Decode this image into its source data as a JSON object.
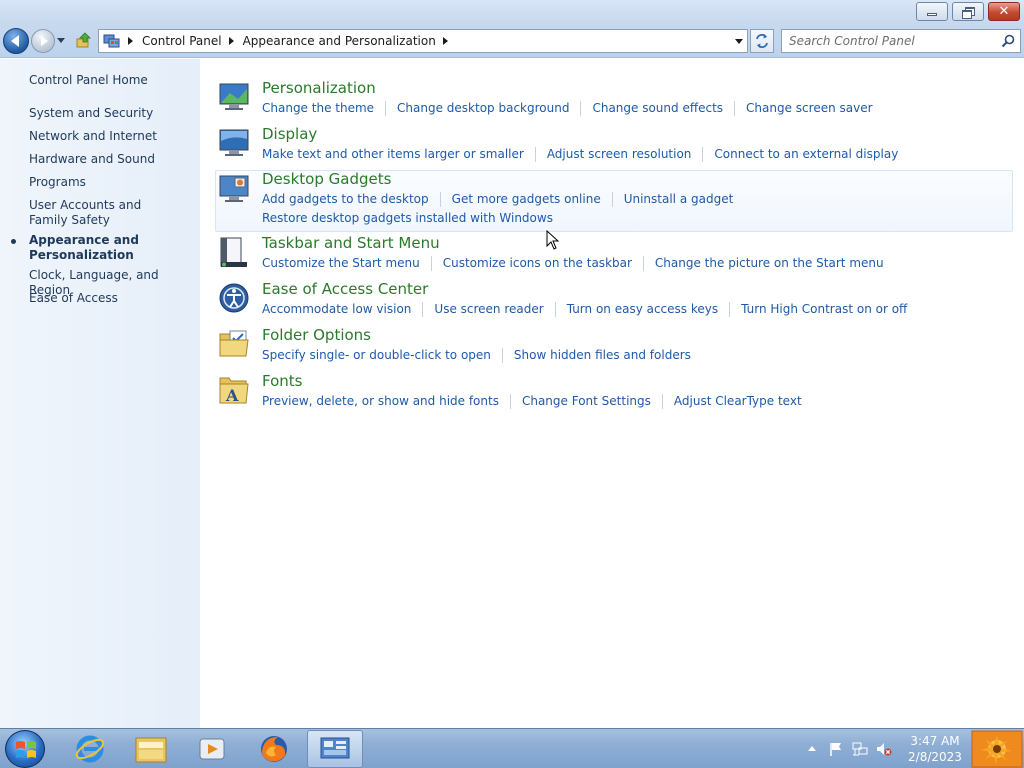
{
  "window": {
    "minimize_icon": "minimize-icon",
    "maximize_icon": "restore-icon",
    "close_icon": "close-icon",
    "close_glyph": "✕"
  },
  "nav": {
    "breadcrumbs": [
      "Control Panel",
      "Appearance and Personalization"
    ],
    "search_placeholder": "Search Control Panel"
  },
  "sidebar": {
    "home": "Control Panel Home",
    "items": [
      {
        "label": "System and Security",
        "active": false
      },
      {
        "label": "Network and Internet",
        "active": false
      },
      {
        "label": "Hardware and Sound",
        "active": false
      },
      {
        "label": "Programs",
        "active": false
      },
      {
        "label": "User Accounts and Family Safety",
        "active": false
      },
      {
        "label": "Appearance and Personalization",
        "active": true
      },
      {
        "label": "Clock, Language, and Region",
        "active": false
      },
      {
        "label": "Ease of Access",
        "active": false
      }
    ]
  },
  "categories": [
    {
      "title": "Personalization",
      "icon": "personalization-icon",
      "links": [
        "Change the theme",
        "Change desktop background",
        "Change sound effects",
        "Change screen saver"
      ]
    },
    {
      "title": "Display",
      "icon": "display-icon",
      "links": [
        "Make text and other items larger or smaller",
        "Adjust screen resolution",
        "Connect to an external display"
      ]
    },
    {
      "title": "Desktop Gadgets",
      "icon": "desktop-gadgets-icon",
      "links": [
        "Add gadgets to the desktop",
        "Get more gadgets online",
        "Uninstall a gadget",
        "Restore desktop gadgets installed with Windows"
      ]
    },
    {
      "title": "Taskbar and Start Menu",
      "icon": "taskbar-icon",
      "links": [
        "Customize the Start menu",
        "Customize icons on the taskbar",
        "Change the picture on the Start menu"
      ]
    },
    {
      "title": "Ease of Access Center",
      "icon": "ease-of-access-icon",
      "links": [
        "Accommodate low vision",
        "Use screen reader",
        "Turn on easy access keys",
        "Turn High Contrast on or off"
      ]
    },
    {
      "title": "Folder Options",
      "icon": "folder-options-icon",
      "links": [
        "Specify single- or double-click to open",
        "Show hidden files and folders"
      ]
    },
    {
      "title": "Fonts",
      "icon": "fonts-icon",
      "links": [
        "Preview, delete, or show and hide fonts",
        "Change Font Settings",
        "Adjust ClearType text"
      ]
    }
  ],
  "taskbar": {
    "pinned": [
      {
        "name": "internet-explorer-icon",
        "active": false
      },
      {
        "name": "file-explorer-icon",
        "active": false
      },
      {
        "name": "media-player-icon",
        "active": false
      },
      {
        "name": "firefox-icon",
        "active": false
      },
      {
        "name": "control-panel-icon",
        "active": true
      }
    ],
    "tray_icons": [
      "show-hidden-icons-arrow-icon",
      "action-center-flag-icon",
      "network-icon",
      "volume-muted-icon"
    ],
    "clock_time": "3:47 AM",
    "clock_date": "2/8/2023"
  },
  "colors": {
    "category_title": "#2b7a2b",
    "link": "#1e5aa8",
    "sidebar_text": "#1e395b"
  }
}
